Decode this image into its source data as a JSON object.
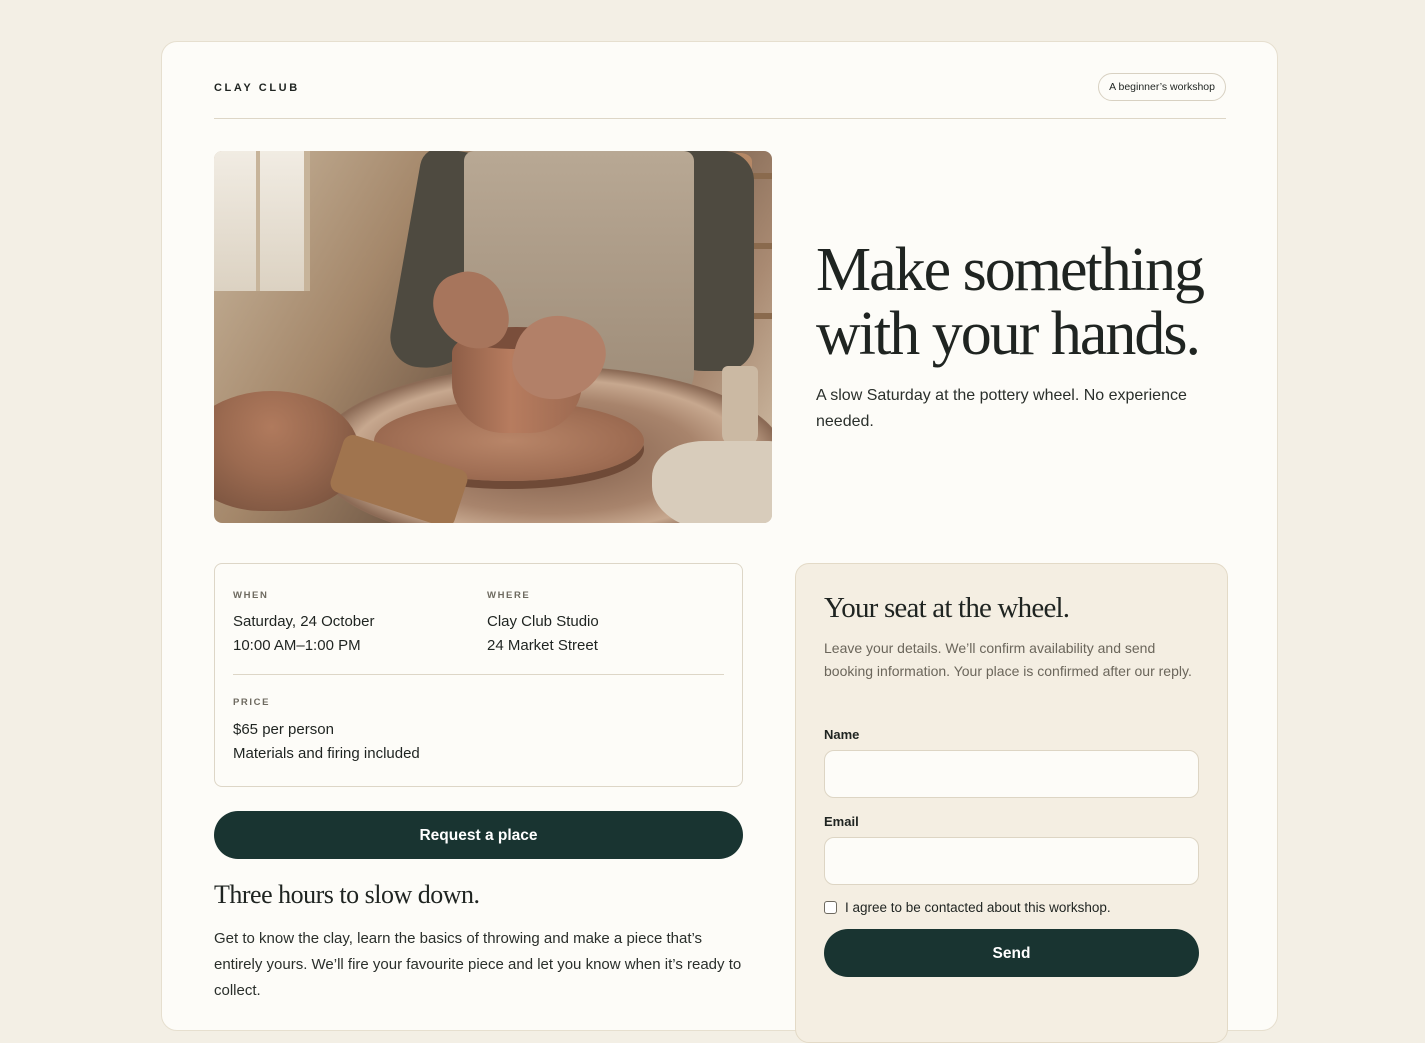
{
  "header": {
    "brand": "CLAY CLUB",
    "badge": "A beginner’s workshop"
  },
  "hero": {
    "image": "pottery-wheel-photo",
    "title": "Make something with your hands.",
    "subtitle": "A slow Saturday at the pottery wheel. No experience needed."
  },
  "details": {
    "when_label": "WHEN",
    "when_line1": "Saturday, 24 October",
    "when_line2": "10:00 AM–1:00 PM",
    "where_label": "WHERE",
    "where_line1": "Clay Club Studio",
    "where_line2": "24 Market Street",
    "price_label": "PRICE",
    "price_line1": "$65 per person",
    "price_line2": "Materials and firing included"
  },
  "request_button": "Request a place",
  "about": {
    "title": "Three hours to slow down.",
    "body": "Get to know the clay, learn the basics of throwing and make a piece that’s entirely yours. We’ll fire your favourite piece and let you know when it’s ready to collect."
  },
  "form": {
    "title": "Your seat at the wheel.",
    "description": "Leave your details. We’ll confirm availability and send booking information. Your place is confirmed after our reply.",
    "name_label": "Name",
    "name_value": "",
    "email_label": "Email",
    "email_value": "",
    "consent_label": "I agree to be contacted about this workshop.",
    "consent_checked": false,
    "send_button": "Send"
  },
  "colors": {
    "page_bg": "#f3efe5",
    "card_bg": "#fdfcf8",
    "form_bg": "#f4eee2",
    "button": "#193431"
  }
}
